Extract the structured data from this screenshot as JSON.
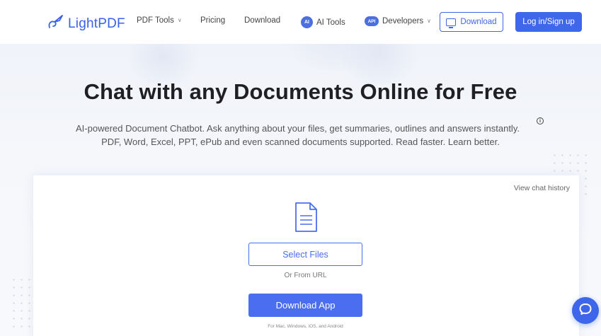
{
  "nav": {
    "logo_text": "LightPDF",
    "items": [
      {
        "label": "PDF Tools",
        "has_dropdown": true
      },
      {
        "label": "Pricing",
        "has_dropdown": false
      },
      {
        "label": "Download",
        "has_dropdown": false
      },
      {
        "label": "AI Tools",
        "has_dropdown": false,
        "badge": "AI"
      },
      {
        "label": "Developers",
        "has_dropdown": true,
        "badge": "API"
      }
    ],
    "download_button": "Download",
    "login_button": "Log in/Sign up"
  },
  "hero": {
    "title": "Chat with any Documents Online for Free",
    "subtitle_line1": "AI-powered Document Chatbot. Ask anything about your files, get summaries, outlines and answers instantly.",
    "subtitle_line2": "PDF, Word, Excel, PPT, ePub and even scanned documents supported. Read faster. Learn better."
  },
  "upload": {
    "history_link": "View chat history",
    "select_files": "Select Files",
    "from_url": "Or From URL",
    "download_app": "Download App",
    "platforms": "For Mac, Windows, iOS, and Android"
  },
  "colors": {
    "accent": "#3f67ec",
    "title": "#1f1f24",
    "background": "#f4f6fb"
  },
  "icons": {
    "logo": "lightpdf-logo-icon",
    "document": "document-icon",
    "chat": "chat-bubble-icon",
    "monitor": "monitor-icon",
    "info": "info-icon"
  }
}
